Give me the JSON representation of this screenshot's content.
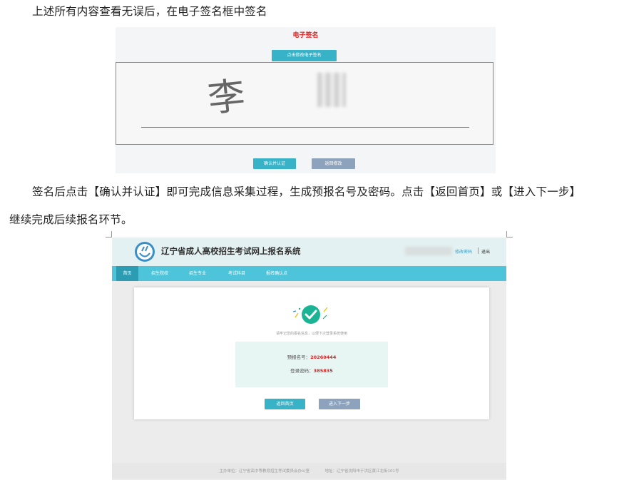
{
  "paragraphs": {
    "p1": "上述所有内容查看无误后，在电子签名框中签名",
    "p2": "签名后点击【确认并认证】即可完成信息采集过程，生成预报名号及密码。点击【返回首页】或【进入下一步】",
    "p3": "继续完成后续报名环节。"
  },
  "signature_panel": {
    "title": "电子签名",
    "modify_button": "点击修改电子签名",
    "signature_text": "李",
    "confirm_button": "确认并认证",
    "return_button": "返回修改"
  },
  "success_page": {
    "site_title": "辽宁省成人高校招生考试网上报名系统",
    "change_password": "修改密码",
    "logout": "退出",
    "nav": [
      "首页",
      "招生院校",
      "招生专业",
      "考试科目",
      "报名确认点"
    ],
    "hint": "请牢记您的报名信息，以便下次登录系统使用",
    "pre_reg_label": "预报名号：",
    "pre_reg_number": "20260444",
    "password_label": "登录密码：",
    "password_value": "385835",
    "home_button": "返回首页",
    "next_button": "进入下一步",
    "footer_sponsor": "主办单位：辽宁省高中等教育招生考试委员会办公室",
    "footer_address": "地址：辽宁省沈阳市于洪区黄江北街101号"
  },
  "colors": {
    "accent_teal": "#37b2c7",
    "nav_teal": "#4dc4d9",
    "success_green": "#1ab394",
    "highlight_red": "#e0201e",
    "button_gray": "#8da3bd"
  }
}
